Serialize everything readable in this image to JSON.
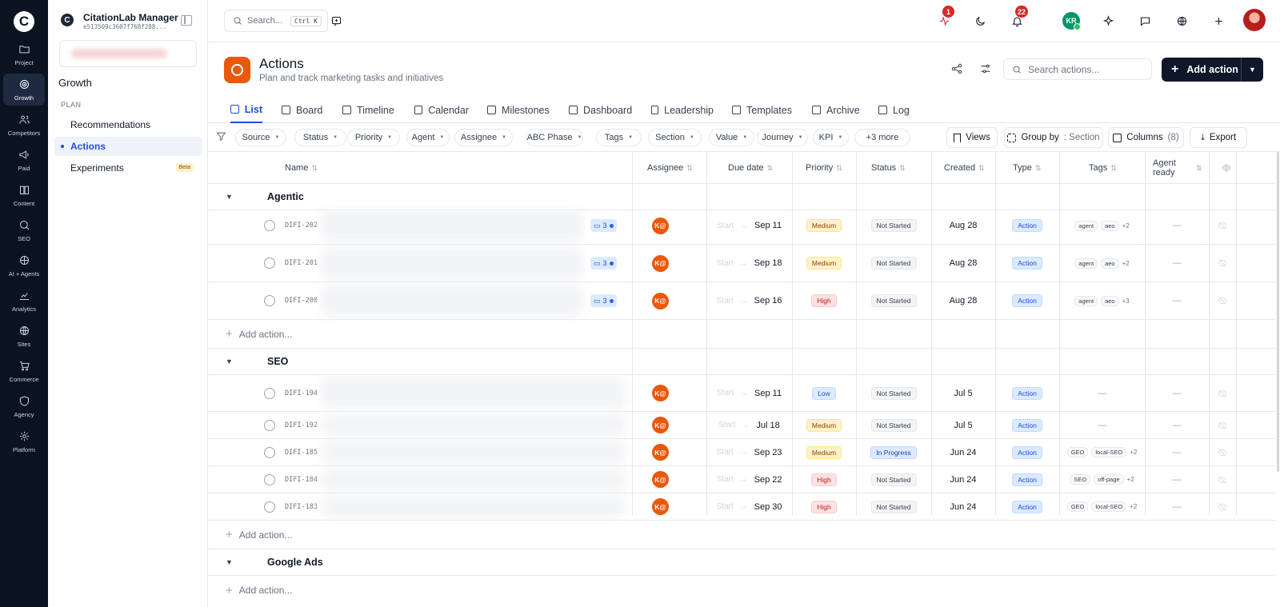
{
  "rail": {
    "logo": "C",
    "items": [
      {
        "label": "Project",
        "icon": "folder-icon"
      },
      {
        "label": "Growth",
        "icon": "target-icon",
        "active": true
      },
      {
        "label": "Competitors",
        "icon": "users-icon"
      },
      {
        "label": "Paid",
        "icon": "megaphone-icon"
      },
      {
        "label": "Content",
        "icon": "book-icon"
      },
      {
        "label": "SEO",
        "icon": "search-icon"
      },
      {
        "label": "AI + Agents",
        "icon": "brain-icon"
      },
      {
        "label": "Analytics",
        "icon": "chart-icon"
      },
      {
        "label": "Sites",
        "icon": "globe-icon"
      },
      {
        "label": "Commerce",
        "icon": "cart-icon"
      },
      {
        "label": "Agency",
        "icon": "shield-icon"
      },
      {
        "label": "Platform",
        "icon": "gear-icon"
      }
    ]
  },
  "panel": {
    "org_logo": "C",
    "org_name": "CitationLab Manager",
    "org_id": "e513509c3607f768f288...",
    "section_title": "Growth",
    "group_label": "PLAN",
    "items": [
      {
        "label": "Recommendations"
      },
      {
        "label": "Actions",
        "active": true
      },
      {
        "label": "Experiments",
        "badge": "Beta"
      }
    ]
  },
  "topbar": {
    "search_placeholder": "Search...",
    "shortcut": "Ctrl K",
    "activity_badge": "1",
    "notifications_badge": "22",
    "user_initials": "KR"
  },
  "header": {
    "title": "Actions",
    "subtitle": "Plan and track marketing tasks and initiatives",
    "search_placeholder": "Search actions...",
    "add_label": "Add action"
  },
  "tabs": [
    {
      "label": "List",
      "active": true
    },
    {
      "label": "Board"
    },
    {
      "label": "Timeline"
    },
    {
      "label": "Calendar"
    },
    {
      "label": "Milestones"
    },
    {
      "label": "Dashboard"
    },
    {
      "label": "Leadership"
    },
    {
      "label": "Templates"
    },
    {
      "label": "Archive"
    },
    {
      "label": "Log"
    }
  ],
  "filters": [
    "Source",
    "Status",
    "Priority",
    "Agent",
    "Assignee",
    "ABC Phase",
    "Tags",
    "Section",
    "Value",
    "Journey",
    "KPI"
  ],
  "more_filters": "+3 more",
  "toolbar": {
    "views": "Views",
    "group_by": "Group by",
    "group_by_value": ": Section",
    "columns": "Columns",
    "columns_count": "(8)",
    "export": "Export"
  },
  "columns": {
    "name": "Name",
    "assignee": "Assignee",
    "due": "Due date",
    "priority": "Priority",
    "status": "Status",
    "created": "Created",
    "type": "Type",
    "tags": "Tags",
    "agent_ready": "Agent ready"
  },
  "groups": [
    {
      "name": "Agentic",
      "add_label": "Add action...",
      "rows": [
        {
          "id": "DIFI-202",
          "comments": "3",
          "assignee": "K@",
          "start": "Start",
          "due": "Sep 11",
          "priority": "Medium",
          "status": "Not Started",
          "created": "Aug 28",
          "type": "Action",
          "tags": [
            "agent",
            "aeo"
          ],
          "tags_more": "+2",
          "agent_ready": "—"
        },
        {
          "id": "DIFI-201",
          "comments": "3",
          "assignee": "K@",
          "start": "Start",
          "due": "Sep 18",
          "priority": "Medium",
          "status": "Not Started",
          "created": "Aug 28",
          "type": "Action",
          "tags": [
            "agent",
            "aeo"
          ],
          "tags_more": "+2",
          "agent_ready": "—"
        },
        {
          "id": "DIFI-200",
          "comments": "3",
          "assignee": "K@",
          "start": "Start",
          "due": "Sep 16",
          "priority": "High",
          "status": "Not Started",
          "created": "Aug 28",
          "type": "Action",
          "tags": [
            "agent",
            "aeo"
          ],
          "tags_more": "+3",
          "agent_ready": "—"
        }
      ]
    },
    {
      "name": "SEO",
      "add_label": "Add action...",
      "rows": [
        {
          "id": "DIFI-194",
          "assignee": "K@",
          "start": "Start",
          "due": "Sep 11",
          "priority": "Low",
          "status": "Not Started",
          "created": "Jul 5",
          "type": "Action",
          "tags": [],
          "tags_empty": "—",
          "agent_ready": "—"
        },
        {
          "id": "DIFI-192",
          "assignee": "K@",
          "start": "Start",
          "due": "Jul 18",
          "priority": "Medium",
          "status": "Not Started",
          "created": "Jul 5",
          "type": "Action",
          "tags": [],
          "tags_empty": "—",
          "agent_ready": "—"
        },
        {
          "id": "DIFI-185",
          "assignee": "K@",
          "start": "Start",
          "due": "Sep 23",
          "priority": "Medium",
          "status": "In Progress",
          "created": "Jun 24",
          "type": "Action",
          "tags": [
            "GEO",
            "local-SEO"
          ],
          "tags_more": "+2",
          "agent_ready": "—"
        },
        {
          "id": "DIFI-184",
          "assignee": "K@",
          "start": "Start",
          "due": "Sep 22",
          "priority": "High",
          "status": "Not Started",
          "created": "Jun 24",
          "type": "Action",
          "tags": [
            "SEO",
            "off-page"
          ],
          "tags_more": "+2",
          "agent_ready": "—"
        },
        {
          "id": "DIFI-183",
          "assignee": "K@",
          "start": "Start",
          "due": "Sep 30",
          "priority": "High",
          "status": "Not Started",
          "created": "Jun 24",
          "type": "Action",
          "tags": [
            "GEO",
            "local-SEO"
          ],
          "tags_more": "+2",
          "agent_ready": "—"
        }
      ]
    },
    {
      "name": "Google Ads",
      "add_label": "Add action...",
      "rows": []
    }
  ]
}
